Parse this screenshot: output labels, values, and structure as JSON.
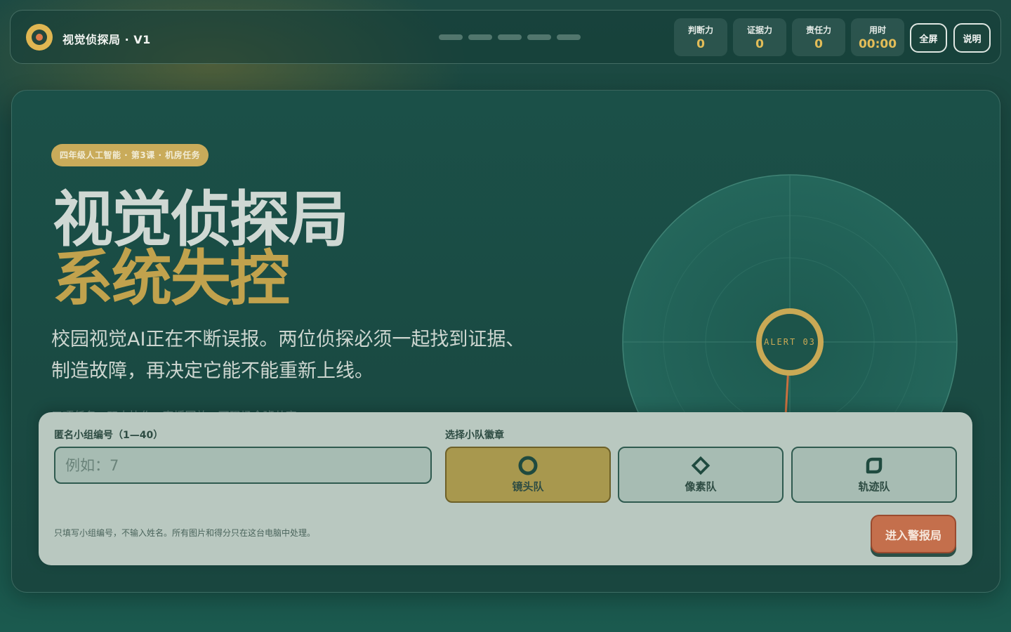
{
  "header": {
    "app_title": "视觉侦探局 · V1",
    "progress_steps": 5,
    "stats": [
      {
        "label": "判断力",
        "value": "0"
      },
      {
        "label": "证据力",
        "value": "0"
      },
      {
        "label": "责任力",
        "value": "0"
      },
      {
        "label": "用时",
        "value": "00:00"
      }
    ],
    "fullscreen_label": "全屏",
    "help_label": "说明"
  },
  "hero": {
    "pill": "四年级人工智能 · 第3课 · 机房任务",
    "title_line1": "视觉侦探局",
    "title_line2": "系统失控",
    "intro": "校园视觉AI正在不断误报。两位侦探必须一起找到证据、制造故障，再决定它能不能重新上线。",
    "faint_line": "三项任务 · 双人协作 · 直播回放 · 可现场全班共享",
    "radar_label": "ALERT 03"
  },
  "form": {
    "group_label": "匿名小组编号（1—40）",
    "group_placeholder": "例如：7",
    "badge_label": "选择小队徽章",
    "badges": [
      {
        "name": "镜头队",
        "icon": "ring-icon",
        "selected": true
      },
      {
        "name": "像素队",
        "icon": "diamond-icon",
        "selected": false
      },
      {
        "name": "轨迹队",
        "icon": "leaf-icon",
        "selected": false
      }
    ],
    "privacy_note": "只填写小组编号，不输入姓名。所有图片和得分只在这台电脑中处理。",
    "enter_label": "进入警报局"
  },
  "colors": {
    "accent_gold": "#e3bd58",
    "accent_orange": "#c46f4c",
    "panel_bg": "#b9c8c0"
  }
}
